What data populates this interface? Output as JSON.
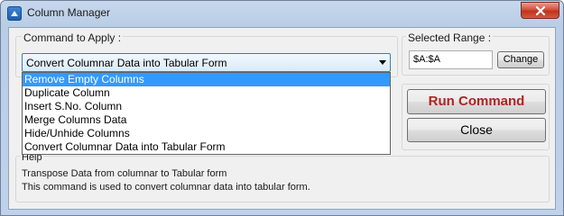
{
  "window": {
    "title": "Column Manager"
  },
  "command": {
    "group_label": "Command to Apply :",
    "selected_value": "Convert Columnar Data into Tabular Form",
    "options": [
      "Remove Empty Columns",
      "Duplicate Column",
      "Insert S.No. Column",
      "Merge Columns Data",
      "Hide/Unhide Columns",
      "Convert Columnar Data into Tabular Form"
    ],
    "highlighted_option": "Remove Empty Columns"
  },
  "range": {
    "group_label": "Selected Range :",
    "value": "$A:$A",
    "change_label": "Change"
  },
  "actions": {
    "run_label": "Run Command",
    "close_label": "Close"
  },
  "help": {
    "label": "Help",
    "line1": "Transpose Data from columnar to Tabular form",
    "line2": "This command is used to convert columnar data into tabular form."
  },
  "colors": {
    "run_text": "#b22222",
    "highlight": "#3399ff"
  },
  "icons": {
    "app": "app-icon",
    "close": "close-icon",
    "dropdown": "chevron-down-icon"
  }
}
